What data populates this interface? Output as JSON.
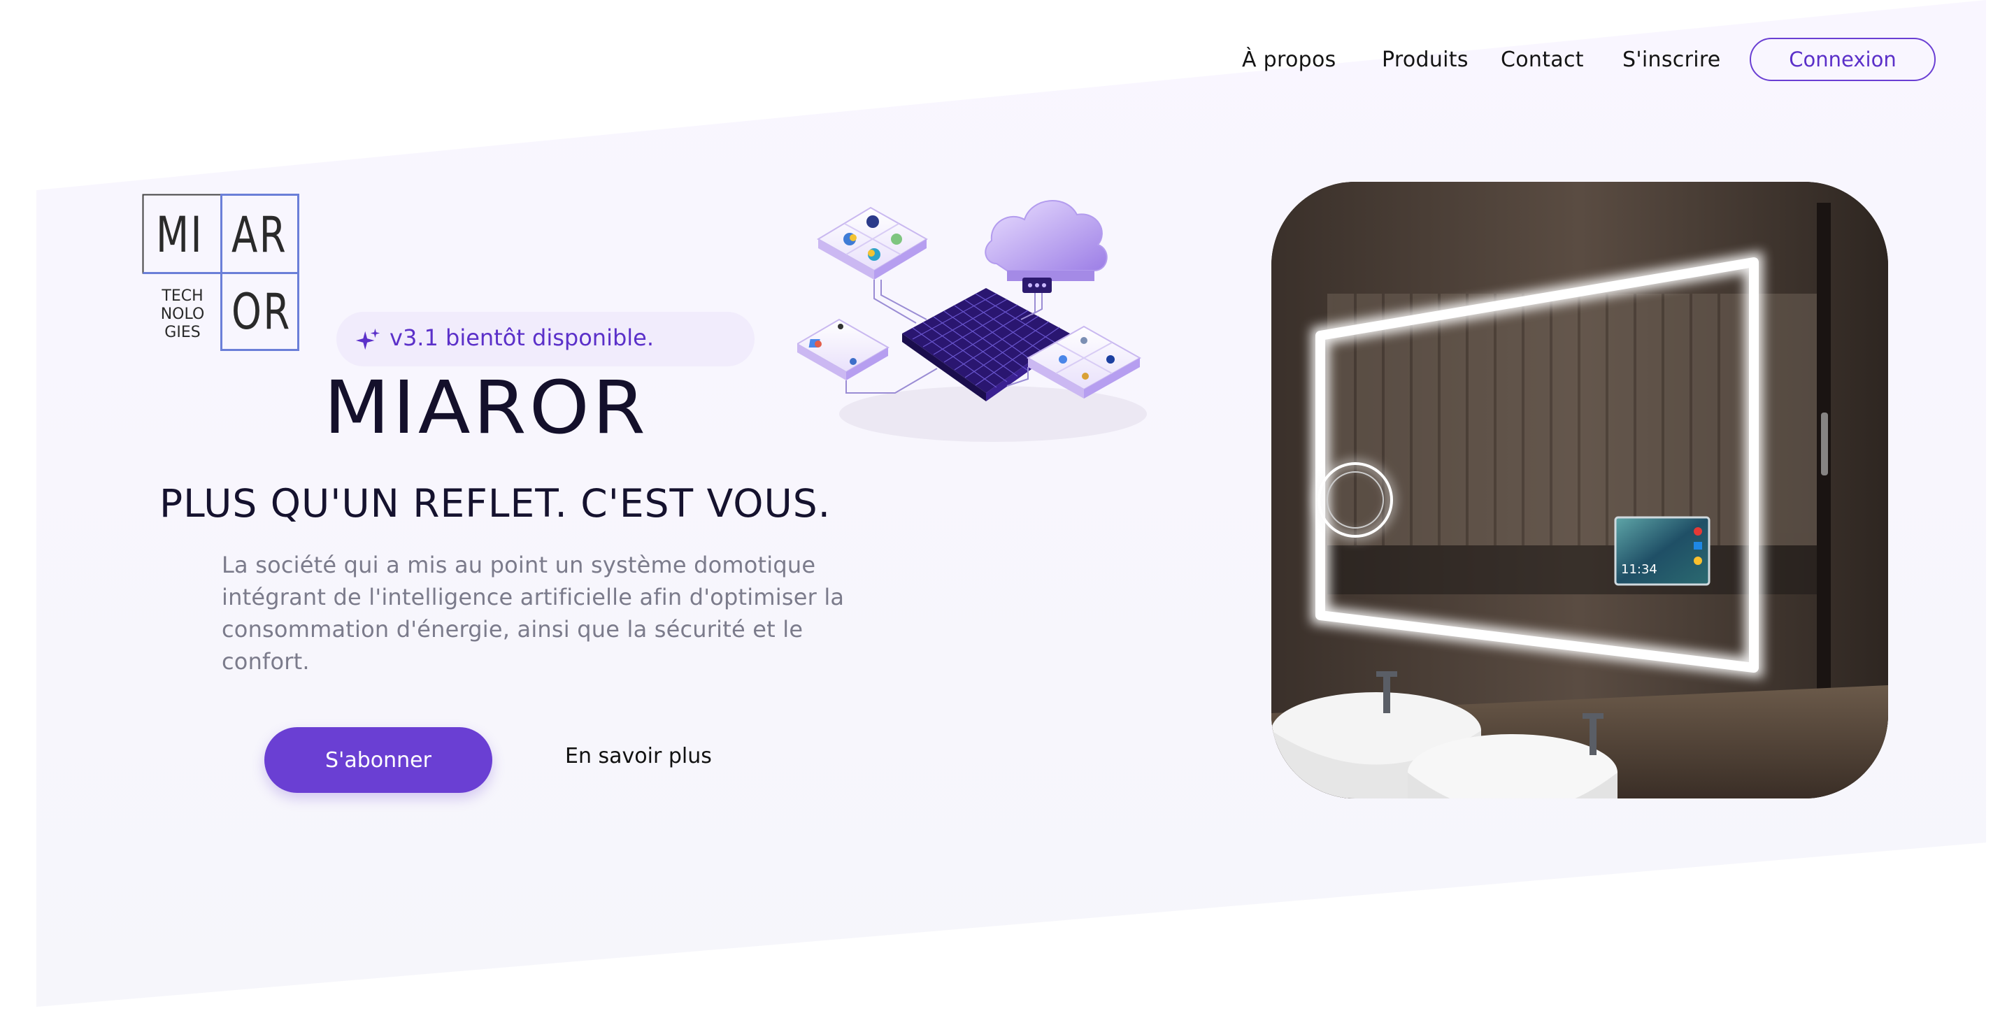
{
  "nav": {
    "links": [
      "À propos",
      "Produits",
      "Contact",
      "S'inscrire"
    ],
    "login_label": "Connexion"
  },
  "logo": {
    "top_left": "MI",
    "top_right": "AR",
    "bottom_left_lines": [
      "TECH",
      "NOLO",
      "GIES"
    ],
    "bottom_right": "OR"
  },
  "hero": {
    "badge": "v3.1 bientôt disponible.",
    "brand": "MIAROR",
    "tagline": "PLUS QU'UN REFLET. C'EST VOUS.",
    "description": "La société qui a mis au point un système domotique intégrant  de l'intelligence artificielle afin d'optimiser la consommation d'énergie, ainsi que la sécurité et le confort.",
    "primary_button": "S'abonner",
    "secondary_link": "En savoir plus"
  },
  "mirror_screen": {
    "time": "11:34"
  },
  "colors": {
    "accent": "#6a3fd3",
    "text_dark": "#14102b",
    "text_muted": "#7b7b8b",
    "badge_bg": "#f1ecfc"
  }
}
